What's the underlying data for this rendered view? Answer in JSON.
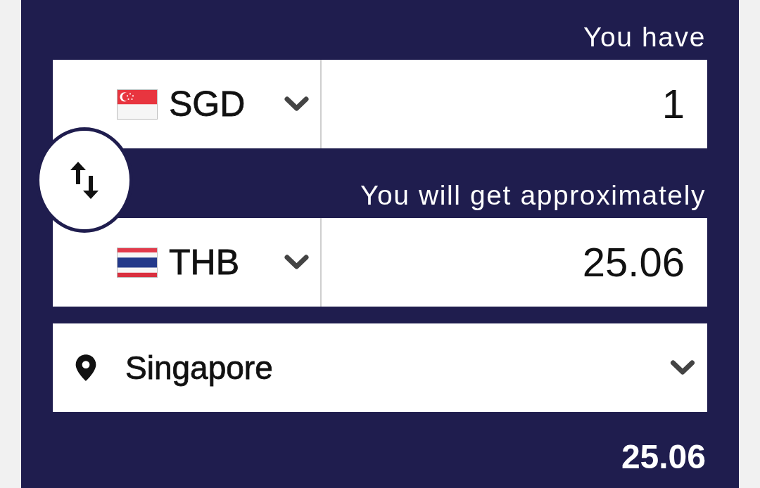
{
  "from": {
    "label": "You have",
    "currency": "SGD",
    "flag": {
      "kind": "singapore"
    },
    "amount": "1"
  },
  "to": {
    "label": "You will get approximately",
    "currency": "THB",
    "flag": {
      "kind": "thailand"
    },
    "amount": "25.06"
  },
  "location": {
    "value": "Singapore"
  },
  "result": "25.06"
}
